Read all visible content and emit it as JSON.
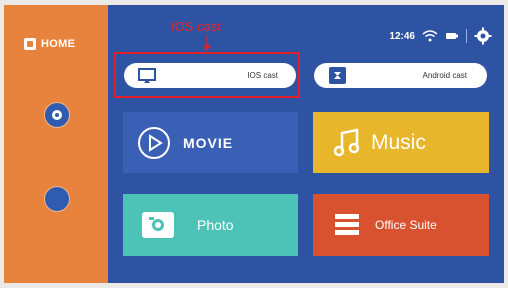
{
  "annotation": {
    "label": "IOS cast"
  },
  "sidebar": {
    "home_label": "HOME",
    "items": [
      {
        "icon": "settings-icon",
        "label": ""
      },
      {
        "icon": "usb-icon",
        "label": "",
        "badge": ""
      }
    ]
  },
  "status_bar": {
    "time": "12:46"
  },
  "cast": {
    "ios_label": "IOS cast",
    "android_label": "Android cast"
  },
  "tiles": {
    "movie": "MOVIE",
    "music": "Music",
    "photo": "Photo",
    "office": "Office Suite"
  },
  "colors": {
    "sidebar": "#e8833d",
    "main_bg": "#2f53a3",
    "movie": "#3a60b6",
    "music": "#e8b62a",
    "photo": "#4cc3b6",
    "office": "#d95230",
    "annotation": "#e01f26"
  }
}
